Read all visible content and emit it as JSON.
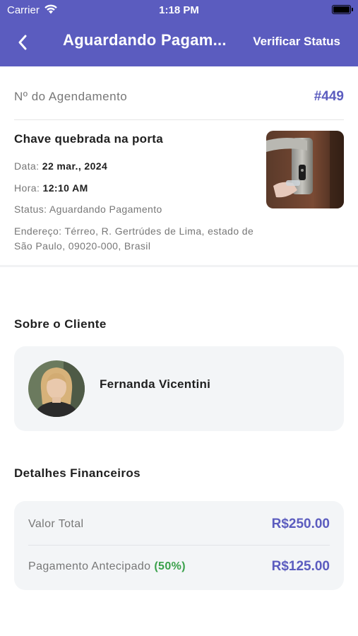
{
  "status_bar": {
    "carrier": "Carrier",
    "time": "1:18 PM"
  },
  "nav": {
    "title": "Aguardando Pagam...",
    "action_label": "Verificar Status"
  },
  "appointment": {
    "number_label": "Nº do Agendamento",
    "number_value": "#449",
    "service_title": "Chave quebrada na porta",
    "date_label": "Data:",
    "date_value": "22 mar., 2024",
    "time_label": "Hora:",
    "time_value": "12:10 AM",
    "status_text": "Status: Aguardando Pagamento",
    "address_text": "Endereço: Térreo, R. Gertrúdes de Lima, estado de São Paulo, 09020-000, Brasil"
  },
  "client": {
    "section_title": "Sobre o Cliente",
    "name": "Fernanda Vicentini"
  },
  "financial": {
    "section_title": "Detalhes Financeiros",
    "total_label": "Valor Total",
    "total_value": "R$250.00",
    "advance_label": "Pagamento Antecipado",
    "advance_percent": "(50%)",
    "advance_value": "R$125.00"
  },
  "colors": {
    "header_bg": "#5b5cbf",
    "accent": "#5b5cbf",
    "success": "#3aa14b",
    "card_bg": "#f3f5f7"
  },
  "icons": [
    "wifi-icon",
    "battery-icon",
    "back-chevron-icon"
  ]
}
